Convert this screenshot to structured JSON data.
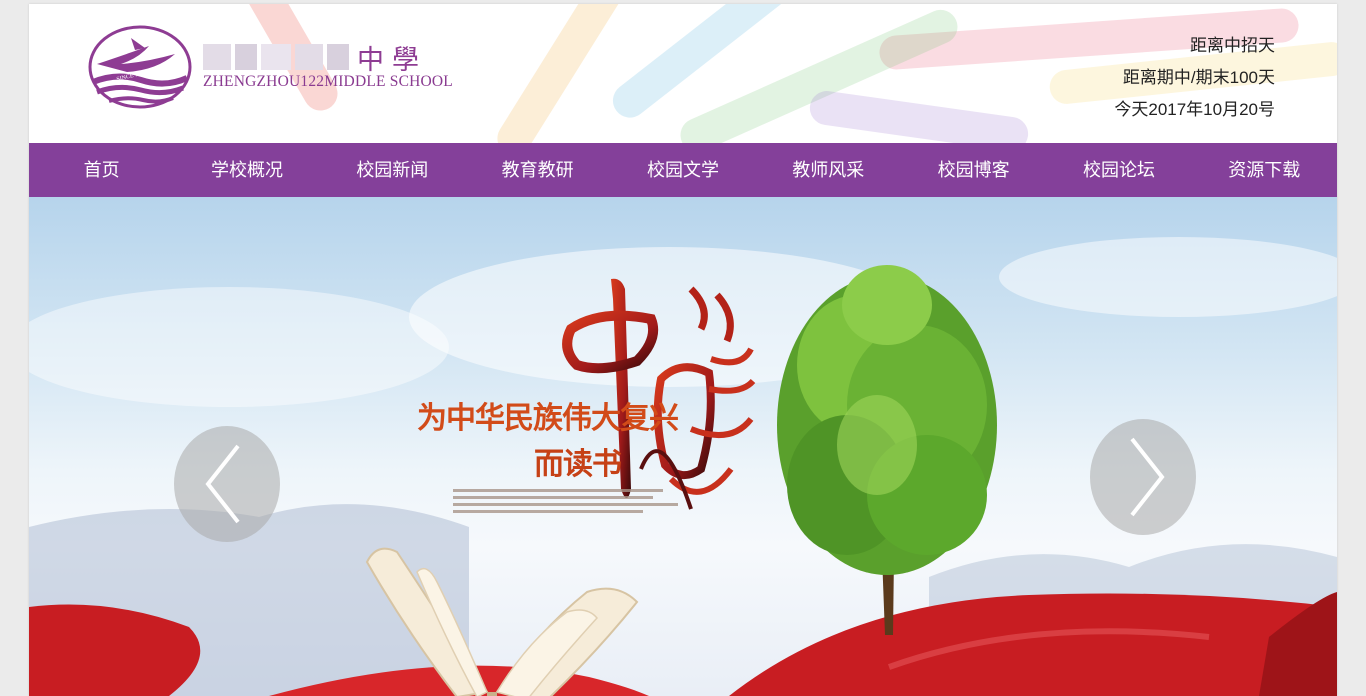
{
  "header": {
    "school_name_cn_visible": "中學",
    "school_name_en": "ZHENGZHOU122MIDDLE SCHOOL",
    "logo_text": "SINCE 1958",
    "countdown": [
      "距离中招天",
      "距离期中/期末100天",
      "今天2017年10月20号"
    ]
  },
  "nav": {
    "items": [
      {
        "label": "首页"
      },
      {
        "label": "学校概况"
      },
      {
        "label": "校园新闻"
      },
      {
        "label": "教育教研"
      },
      {
        "label": "校园文学"
      },
      {
        "label": "教师风采"
      },
      {
        "label": "校园博客"
      },
      {
        "label": "校园论坛"
      },
      {
        "label": "资源下载"
      }
    ]
  },
  "banner": {
    "calligraphy": "中國夢",
    "slogan_line1": "为中华民族伟大复兴",
    "slogan_line2": "而读书",
    "prev_icon": "chevron-left-icon",
    "next_icon": "chevron-right-icon"
  },
  "colors": {
    "nav_bg": "#84409a",
    "brand_purple": "#8e3c93",
    "slogan_orange": "#d24b19",
    "ribbon_red": "#c81d22"
  }
}
